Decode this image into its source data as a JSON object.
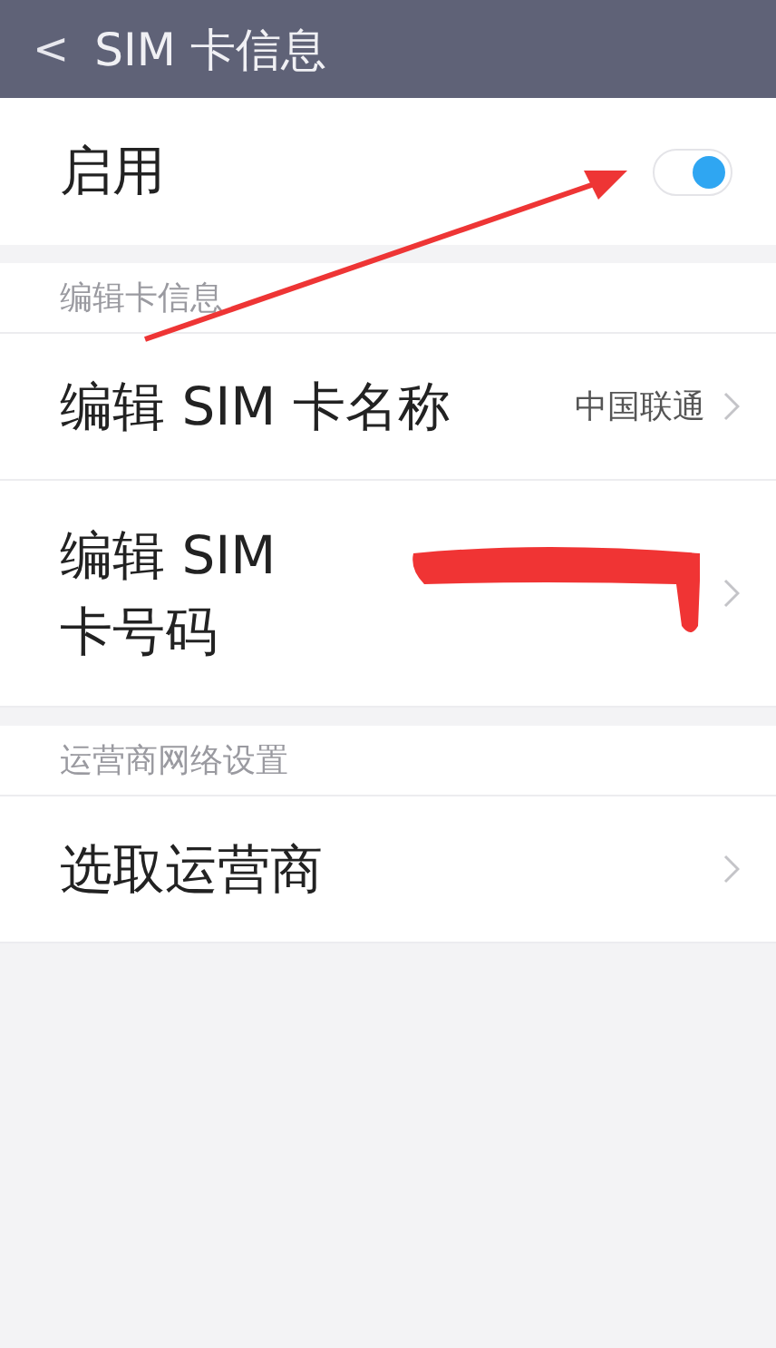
{
  "header": {
    "back": "<",
    "title": "SIM 卡信息"
  },
  "enable": {
    "label": "启用",
    "on": true
  },
  "sections": [
    {
      "title": "编辑卡信息",
      "rows": [
        {
          "kind": "value",
          "label": "编辑 SIM 卡名称",
          "value": "中国联通"
        },
        {
          "kind": "redacted",
          "label": "编辑 SIM 卡号码"
        }
      ]
    },
    {
      "title": "运营商网络设置",
      "rows": [
        {
          "kind": "plain",
          "label": "选取运营商"
        }
      ]
    }
  ]
}
